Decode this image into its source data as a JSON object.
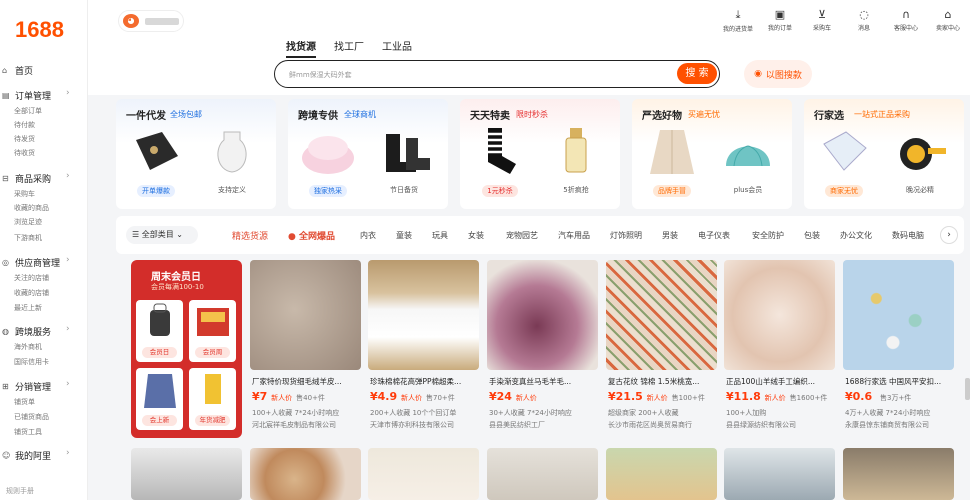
{
  "app": {
    "logo": "1688"
  },
  "sidebar": {
    "items": [
      {
        "label": "首页",
        "icon": "home-icon"
      },
      {
        "label": "订单管理",
        "icon": "order-icon",
        "subs": [
          "全部订单",
          "待付款",
          "待发货",
          "待收货"
        ]
      },
      {
        "label": "商品采购",
        "icon": "cart-icon",
        "subs": [
          "采购车",
          "收藏的商品",
          "浏览足迹",
          "下游商机"
        ]
      },
      {
        "label": "供应商管理",
        "icon": "supplier-icon",
        "subs": [
          "关注的店铺",
          "收藏的店铺",
          "最近上新"
        ]
      },
      {
        "label": "跨境服务",
        "icon": "globe-icon",
        "subs": [
          "海外商机",
          "国际信用卡"
        ]
      },
      {
        "label": "分销管理",
        "icon": "share-icon",
        "subs": [
          "铺货单",
          "已铺货商品",
          "铺货工具"
        ]
      },
      {
        "label": "我的阿里",
        "icon": "user-icon"
      }
    ],
    "bottom": "规则手册"
  },
  "header": {
    "tabs": [
      "找货源",
      "找工厂",
      "工业品"
    ],
    "search_placeholder": "鲜mm保湿大码外套",
    "search_button": "搜 索",
    "image_search": "以图搜款",
    "icons": [
      {
        "label": "我的进货单",
        "icon": "download-icon"
      },
      {
        "label": "我的订单",
        "icon": "order-doc-icon"
      },
      {
        "label": "采购车",
        "icon": "cart-icon"
      },
      {
        "label": "消息",
        "icon": "chat-icon"
      },
      {
        "label": "客服中心",
        "icon": "headset-icon"
      },
      {
        "label": "卖家中心",
        "icon": "seller-icon"
      }
    ]
  },
  "promo_cards": [
    {
      "title": "一件代发",
      "sub": "全场包邮",
      "subcolor": "#1e6fe0",
      "items": [
        {
          "label": "开单爆款",
          "tag": true
        },
        {
          "label": "支持定义",
          "tag": false
        }
      ]
    },
    {
      "title": "跨境专供",
      "sub": "全球商机",
      "subcolor": "#1e6fe0",
      "items": [
        {
          "label": "独家热采",
          "tag": true
        },
        {
          "label": "节日备货",
          "tag": false
        }
      ]
    },
    {
      "title": "天天特卖",
      "sub": "限时秒杀",
      "subcolor": "#e52d2d",
      "items": [
        {
          "label": "1元秒杀",
          "tag": true
        },
        {
          "label": "5折疯抢",
          "tag": false
        }
      ]
    },
    {
      "title": "严选好物",
      "sub": "买遍无忧",
      "subcolor": "#ff6a00",
      "items": [
        {
          "label": "品牌手冒",
          "tag": true
        },
        {
          "label": "plus会员",
          "tag": false
        }
      ]
    },
    {
      "title": "行家选",
      "sub": "一站式正品采购",
      "subcolor": "#ff6a00",
      "items": [
        {
          "label": "商家无忧",
          "tag": true
        },
        {
          "label": "晚况必精",
          "tag": false
        }
      ]
    }
  ],
  "categories": {
    "all": "全部类目",
    "highlight1": "精选货源",
    "highlight2": "全网爆品",
    "items": [
      "内衣",
      "童装",
      "玩具",
      "女装",
      "宠物园艺",
      "汽车用品",
      "灯饰照明",
      "男装",
      "电子仪表",
      "安全防护",
      "包装",
      "办公文化",
      "数码电脑"
    ]
  },
  "featured": {
    "title": "周末会员日",
    "subtitle": "会员每满100-10",
    "boxes": [
      "会员日",
      "会员周",
      "会上新",
      "年货减肥"
    ]
  },
  "products": [
    {
      "title": "厂家特价现货细毛绒羊皮...",
      "price": "¥7",
      "price_note": "新人价",
      "sold": "售40+件",
      "meta": "100+人收藏  7*24小时响应",
      "shop": "河北宸祥毛皮制品有限公司"
    },
    {
      "title": "珍珠棉棉花高弹PP棉超柔...",
      "price": "¥4.9",
      "price_note": "新人价",
      "sold": "售70+件",
      "meta": "200+人收藏  10个个回订单",
      "shop": "天津市博亦利科技有限公司"
    },
    {
      "title": "手染渐变真丝马毛羊毛...",
      "price": "¥24",
      "price_note": "新人价",
      "sold": "",
      "meta": "30+人收藏  7*24小时响应",
      "shop": "县县美民纺织工厂"
    },
    {
      "title": "复古花纹 锦棉 1.5米桃宽...",
      "price": "¥21.5",
      "price_note": "新人价",
      "sold": "售100+件",
      "meta": "超级商家  200+人收藏",
      "shop": "长沙市雨花区尚奥贸易商行"
    },
    {
      "title": "正品100山羊绒手工编织...",
      "price": "¥11.8",
      "price_note": "新人价",
      "sold": "售1600+件",
      "meta": "100+人加购",
      "shop": "县县绿源纺织有限公司"
    },
    {
      "title": "1688行家选 中国风平安扣...",
      "price": "¥0.6",
      "price_note": "",
      "sold": "售3万+件",
      "meta": "4万+人收藏  7*24小时响应",
      "shop": "永康县惊东铺商贸有限公司"
    }
  ],
  "colors": {
    "brand": "#ff5000",
    "price": "#ff3b0a"
  }
}
